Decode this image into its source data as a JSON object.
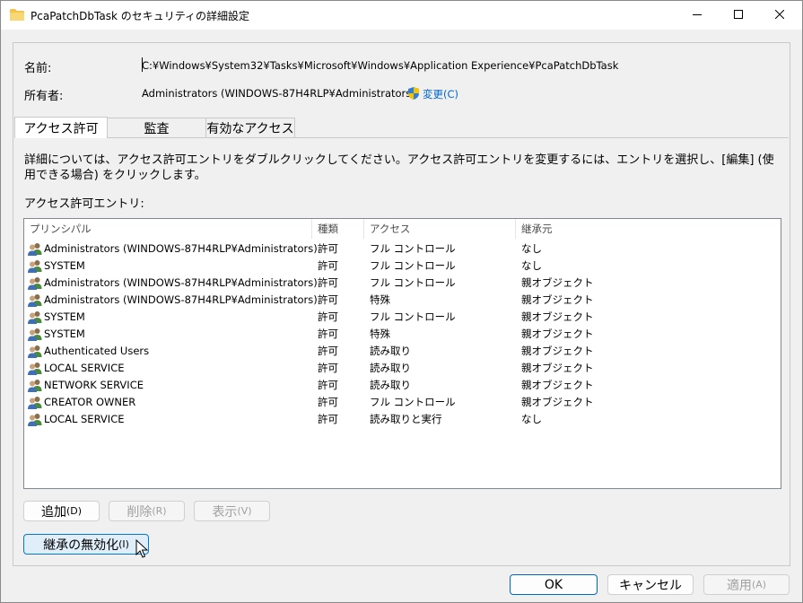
{
  "window": {
    "title": "PcaPatchDbTask のセキュリティの詳細設定"
  },
  "header": {
    "name_label": "名前:",
    "name_value": "C:¥Windows¥System32¥Tasks¥Microsoft¥Windows¥Application Experience¥PcaPatchDbTask",
    "owner_label": "所有者:",
    "owner_value": "Administrators (WINDOWS-87H4RLP¥Administrators)",
    "change_link": "変更(C)"
  },
  "tabs": [
    {
      "label": "アクセス許可",
      "active": true
    },
    {
      "label": "監査",
      "active": false
    },
    {
      "label": "有効なアクセス",
      "active": false
    }
  ],
  "permissions": {
    "description": "詳細については、アクセス許可エントリをダブルクリックしてください。アクセス許可エントリを変更するには、エントリを選択し、[編集] (使用できる場合) をクリックします。",
    "entries_label": "アクセス許可エントリ:",
    "columns": [
      "プリンシパル",
      "種類",
      "アクセス",
      "継承元"
    ],
    "rows": [
      {
        "principal": "Administrators (WINDOWS-87H4RLP¥Administrators)",
        "type": "許可",
        "access": "フル コントロール",
        "inherited": "なし"
      },
      {
        "principal": "SYSTEM",
        "type": "許可",
        "access": "フル コントロール",
        "inherited": "なし"
      },
      {
        "principal": "Administrators (WINDOWS-87H4RLP¥Administrators)",
        "type": "許可",
        "access": "フル コントロール",
        "inherited": "親オブジェクト"
      },
      {
        "principal": "Administrators (WINDOWS-87H4RLP¥Administrators)",
        "type": "許可",
        "access": "特殊",
        "inherited": "親オブジェクト"
      },
      {
        "principal": "SYSTEM",
        "type": "許可",
        "access": "フル コントロール",
        "inherited": "親オブジェクト"
      },
      {
        "principal": "SYSTEM",
        "type": "許可",
        "access": "特殊",
        "inherited": "親オブジェクト"
      },
      {
        "principal": "Authenticated Users",
        "type": "許可",
        "access": "読み取り",
        "inherited": "親オブジェクト"
      },
      {
        "principal": "LOCAL SERVICE",
        "type": "許可",
        "access": "読み取り",
        "inherited": "親オブジェクト"
      },
      {
        "principal": "NETWORK SERVICE",
        "type": "許可",
        "access": "読み取り",
        "inherited": "親オブジェクト"
      },
      {
        "principal": "CREATOR OWNER",
        "type": "許可",
        "access": "フル コントロール",
        "inherited": "親オブジェクト"
      },
      {
        "principal": "LOCAL SERVICE",
        "type": "許可",
        "access": "読み取りと実行",
        "inherited": "なし"
      }
    ],
    "buttons": {
      "add": "追加",
      "add_key": "(D)",
      "delete": "削除",
      "delete_key": "(R)",
      "view": "表示",
      "view_key": "(V)",
      "disable_inheritance": "継承の無効化",
      "disable_inheritance_key": "(I)"
    }
  },
  "footer": {
    "ok": "OK",
    "cancel": "キャンセル",
    "apply": "適用",
    "apply_key": "(A)"
  },
  "colors": {
    "link": "#0066cc",
    "focus_border": "#0078d4",
    "folder": "#f3c34a"
  }
}
